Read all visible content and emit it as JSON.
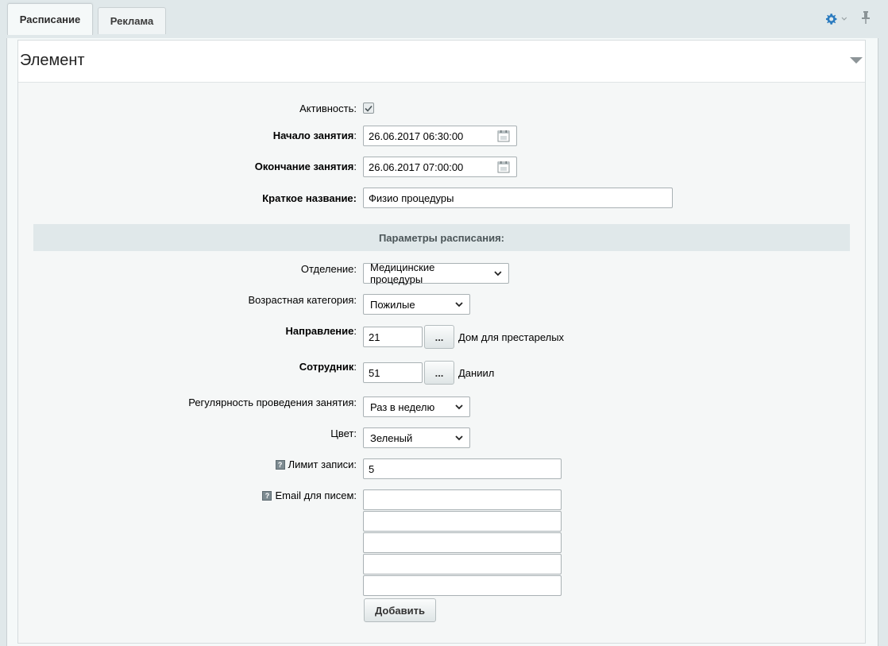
{
  "tabs": [
    {
      "label": "Расписание",
      "active": true
    },
    {
      "label": "Реклама",
      "active": false
    }
  ],
  "toolbar": {
    "settings_icon": "gear-icon",
    "pin_icon": "pin-icon"
  },
  "section": {
    "title": "Элемент"
  },
  "form": {
    "active": {
      "label": "Активность:",
      "checked": true
    },
    "start": {
      "label": "Начало занятия",
      "value": "26.06.2017 06:30:00"
    },
    "end": {
      "label": "Окончание занятия",
      "value": "26.06.2017 07:00:00"
    },
    "short_name": {
      "label": "Краткое название:",
      "value": "Физио процедуры"
    },
    "params_header": "Параметры расписания:",
    "department": {
      "label": "Отделение:",
      "value": "Медицинские процедуры"
    },
    "age_category": {
      "label": "Возрастная категория:",
      "value": "Пожилые"
    },
    "direction": {
      "label": "Направление",
      "value": "21",
      "button": "...",
      "text": "Дом для престарелых"
    },
    "employee": {
      "label": "Сотрудник",
      "value": "51",
      "button": "...",
      "text": "Даниил"
    },
    "regularity": {
      "label": "Регулярность проведения занятия:",
      "value": "Раз в неделю"
    },
    "color": {
      "label": "Цвет:",
      "value": "Зеленый"
    },
    "limit": {
      "label": "Лимит записи:",
      "value": "5",
      "help": "?"
    },
    "email": {
      "label": "Email для писем:",
      "help": "?",
      "values": [
        "",
        "",
        "",
        "",
        ""
      ]
    },
    "add_button": "Добавить"
  },
  "colors": {
    "background": "#e0e8ea",
    "panel": "#f5f9f9",
    "subheader": "#e0e8ea",
    "gear": "#2b7bbf"
  }
}
